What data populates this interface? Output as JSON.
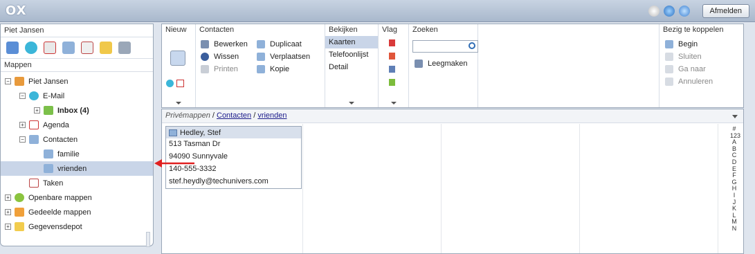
{
  "app": {
    "logo": "OX",
    "logout": "Afmelden"
  },
  "left": {
    "user": "Piet Jansen",
    "mappen": "Mappen",
    "tree": [
      {
        "label": "Piet Jansen",
        "indent": 0,
        "exp": "−"
      },
      {
        "label": "E-Mail",
        "indent": 1,
        "exp": "−"
      },
      {
        "label": "Inbox (4)",
        "indent": 2,
        "exp": "+"
      },
      {
        "label": "Agenda",
        "indent": 1,
        "exp": "+"
      },
      {
        "label": "Contacten",
        "indent": 1,
        "exp": "−"
      },
      {
        "label": "familie",
        "indent": 2,
        "exp": ""
      },
      {
        "label": "vrienden",
        "indent": 2,
        "exp": ""
      },
      {
        "label": "Taken",
        "indent": 1,
        "exp": ""
      },
      {
        "label": "Openbare mappen",
        "indent": 0,
        "exp": "+"
      },
      {
        "label": "Gedeelde mappen",
        "indent": 0,
        "exp": "+"
      },
      {
        "label": "Gegevensdepot",
        "indent": 0,
        "exp": "+"
      }
    ]
  },
  "toolbar": {
    "nieuw": "Nieuw",
    "contacten": {
      "title": "Contacten",
      "bewerken": "Bewerken",
      "wissen": "Wissen",
      "printen": "Printen",
      "duplicaat": "Duplicaat",
      "verplaatsen": "Verplaatsen",
      "kopie": "Kopie"
    },
    "bekijken": {
      "title": "Bekijken",
      "kaarten": "Kaarten",
      "telefoonlijst": "Telefoonlijst",
      "detail": "Detail"
    },
    "vlag": {
      "title": "Vlag"
    },
    "zoeken": {
      "title": "Zoeken",
      "leegmaken": "Leegmaken"
    },
    "koppelen": {
      "title": "Bezig te koppelen",
      "begin": "Begin",
      "sluiten": "Sluiten",
      "ganaar": "Ga naar",
      "annuleren": "Annuleren"
    }
  },
  "content": {
    "crumb_root": "Privémappen",
    "crumb_sep1": " / ",
    "crumb_contacten": "Contacten",
    "crumb_sep2": " / ",
    "crumb_vrienden": "vrienden",
    "card": {
      "name": "Hedley, Stef",
      "street": "513 Tasman Dr",
      "city": "94090 Sunnyvale",
      "phone": "140-555-3332",
      "email": "stef.heydly@techunivers.com"
    },
    "alphabet": [
      "#",
      "123",
      "A",
      "B",
      "C",
      "D",
      "E",
      "F",
      "G",
      "H",
      "I",
      "J",
      "K",
      "L",
      "M",
      "N"
    ]
  },
  "colors": {
    "accent": "#c9d5e8",
    "arrow": "#e02020"
  }
}
